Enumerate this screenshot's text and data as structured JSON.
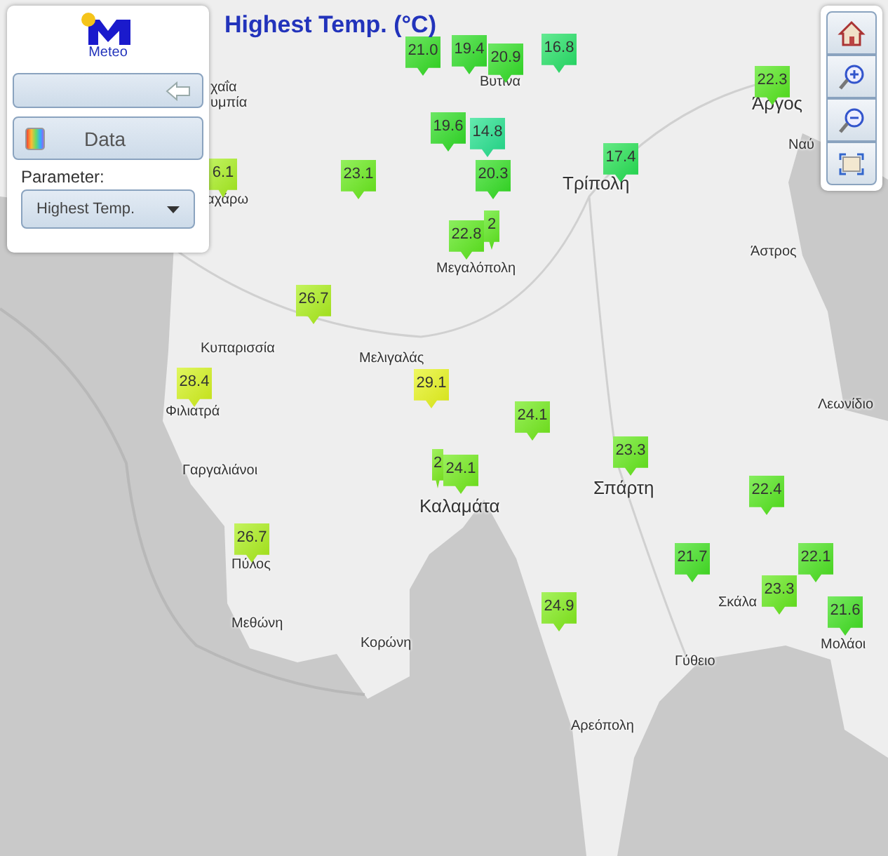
{
  "map_title": "Highest Temp. (°C)",
  "panel": {
    "logo_text": "Meteo",
    "data_button": "Data",
    "parameter_label": "Parameter:",
    "parameter_value": "Highest Temp."
  },
  "place_labels": [
    {
      "name": "χαΐα",
      "kind": "small"
    },
    {
      "name": "υμπία",
      "kind": "small"
    },
    {
      "name": "Βυτινα",
      "kind": "small"
    },
    {
      "name": "Άργος",
      "kind": "big"
    },
    {
      "name": "Ναύ",
      "kind": "small"
    },
    {
      "name": "Τρίπολη",
      "kind": "big"
    },
    {
      "name": "αχάρω",
      "kind": "small"
    },
    {
      "name": "Μεγαλόπολη",
      "kind": "small"
    },
    {
      "name": "Άστρος",
      "kind": "small"
    },
    {
      "name": "Κυπαρισσία",
      "kind": "small"
    },
    {
      "name": "Μελιγαλάς",
      "kind": "small"
    },
    {
      "name": "Φιλιατρά",
      "kind": "small"
    },
    {
      "name": "Λεωνίδιο",
      "kind": "small"
    },
    {
      "name": "Σπάρτη",
      "kind": "big"
    },
    {
      "name": "Γαργαλιάνοι",
      "kind": "small"
    },
    {
      "name": "Καλαμάτα",
      "kind": "big"
    },
    {
      "name": "Πύλος",
      "kind": "small"
    },
    {
      "name": "Σκάλα",
      "kind": "small"
    },
    {
      "name": "Μεθώνη",
      "kind": "small"
    },
    {
      "name": "Μολάοι",
      "kind": "small"
    },
    {
      "name": "Κορώνη",
      "kind": "small"
    },
    {
      "name": "Γύθειο",
      "kind": "small"
    },
    {
      "name": "Αρεόπολη",
      "kind": "small"
    }
  ],
  "markers": [
    {
      "value": "6.1",
      "color": "#a6ee1c"
    },
    {
      "value": "23.1",
      "color": "#66ea18"
    },
    {
      "value": "21.0",
      "color": "#30dc20"
    },
    {
      "value": "19.4",
      "color": "#2cdc24"
    },
    {
      "value": "20.9",
      "color": "#2ede22"
    },
    {
      "value": "16.8",
      "color": "#22e064"
    },
    {
      "value": "19.6",
      "color": "#2cdc22"
    },
    {
      "value": "14.8",
      "color": "#22e08c"
    },
    {
      "value": "20.3",
      "color": "#30de20"
    },
    {
      "value": "2",
      "color": "#5ae81a"
    },
    {
      "value": "22.8",
      "color": "#5ae81a"
    },
    {
      "value": "17.4",
      "color": "#22e050"
    },
    {
      "value": "22.3",
      "color": "#52e61a"
    },
    {
      "value": "26.7",
      "color": "#aaee18"
    },
    {
      "value": "28.4",
      "color": "#d2f21a"
    },
    {
      "value": "29.1",
      "color": "#e6f41a"
    },
    {
      "value": "24.1",
      "color": "#70ea18"
    },
    {
      "value": "2",
      "color": "#78ea18"
    },
    {
      "value": "24.1",
      "color": "#70ea18"
    },
    {
      "value": "23.3",
      "color": "#62e818"
    },
    {
      "value": "22.4",
      "color": "#52e61a"
    },
    {
      "value": "26.7",
      "color": "#aaee18"
    },
    {
      "value": "21.7",
      "color": "#3ee01e"
    },
    {
      "value": "22.1",
      "color": "#48e21c"
    },
    {
      "value": "23.3",
      "color": "#62e818"
    },
    {
      "value": "21.6",
      "color": "#3ee01e"
    },
    {
      "value": "24.9",
      "color": "#80ec18"
    }
  ]
}
